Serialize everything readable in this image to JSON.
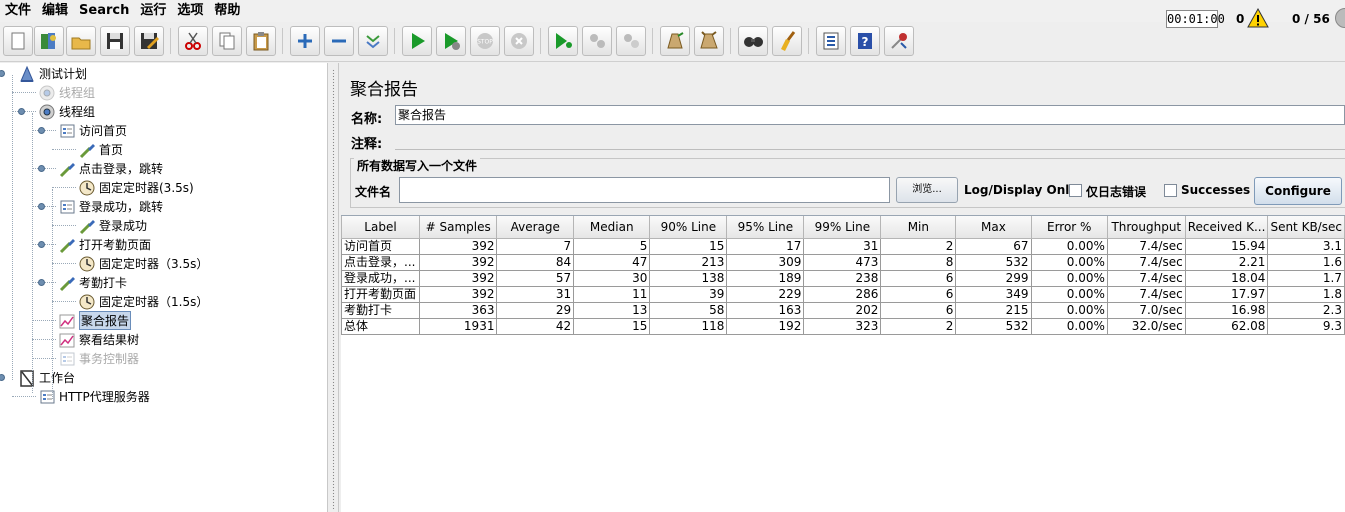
{
  "menu": [
    "文件",
    "编辑",
    "Search",
    "运行",
    "选项",
    "帮助"
  ],
  "toolbar": {
    "buttons": [
      "new-icon",
      "templates-icon",
      "open-icon",
      "save-icon",
      "save-as-icon",
      "cut-icon",
      "copy-icon",
      "paste-icon",
      "expand-icon",
      "collapse-icon",
      "toggle-icon",
      "start-icon",
      "start-no-pause-icon",
      "stop-icon",
      "shutdown-icon",
      "remote-start-icon",
      "remote-stop-icon",
      "remote-shutdown-icon",
      "clear-icon",
      "clear-all-icon",
      "search-icon",
      "reset-search-icon",
      "function-helper-icon",
      "help-icon",
      "log-viewer-icon"
    ],
    "elapsed": "00:01:00",
    "error_count": "0",
    "thread_count": "0 / 56"
  },
  "tree": [
    {
      "label": "测试计划",
      "icon": "test-plan-icon",
      "disabled": false,
      "selected": false
    },
    {
      "label": "线程组",
      "icon": "thread-group-icon",
      "disabled": true,
      "selected": false
    },
    {
      "label": "线程组",
      "icon": "thread-group-icon",
      "disabled": false,
      "selected": false
    },
    {
      "label": "访问首页",
      "icon": "transaction-controller-icon",
      "disabled": false,
      "selected": false
    },
    {
      "label": "首页",
      "icon": "http-sampler-icon",
      "disabled": false,
      "selected": false
    },
    {
      "label": "点击登录，跳转",
      "icon": "http-sampler-icon",
      "disabled": false,
      "selected": false
    },
    {
      "label": "固定定时器(3.5s)",
      "icon": "timer-icon",
      "disabled": false,
      "selected": false
    },
    {
      "label": "登录成功，跳转",
      "icon": "transaction-controller-icon",
      "disabled": false,
      "selected": false
    },
    {
      "label": "登录成功",
      "icon": "http-sampler-icon",
      "disabled": false,
      "selected": false
    },
    {
      "label": "打开考勤页面",
      "icon": "http-sampler-icon",
      "disabled": false,
      "selected": false
    },
    {
      "label": "固定定时器（3.5s）",
      "icon": "timer-icon",
      "disabled": false,
      "selected": false
    },
    {
      "label": "考勤打卡",
      "icon": "http-sampler-icon",
      "disabled": false,
      "selected": false
    },
    {
      "label": "固定定时器（1.5s）",
      "icon": "timer-icon",
      "disabled": false,
      "selected": false
    },
    {
      "label": "聚合报告",
      "icon": "listener-icon",
      "disabled": false,
      "selected": true
    },
    {
      "label": "察看结果树",
      "icon": "listener-icon",
      "disabled": false,
      "selected": false
    },
    {
      "label": "事务控制器",
      "icon": "transaction-controller-icon",
      "disabled": true,
      "selected": false
    },
    {
      "label": "工作台",
      "icon": "workbench-icon",
      "disabled": false,
      "selected": false
    },
    {
      "label": "HTTP代理服务器",
      "icon": "proxy-icon",
      "disabled": false,
      "selected": false
    }
  ],
  "panel": {
    "title": "聚合报告",
    "name_label": "名称:",
    "name_value": "聚合报告",
    "comment_label": "注释:",
    "comment_value": "",
    "group_title": "所有数据写入一个文件",
    "filename_label": "文件名",
    "filename_value": "",
    "browse_label": "浏览...",
    "log_display_label": "Log/Display Only:",
    "errors_only_label": "仅日志错误",
    "successes_label": "Successes",
    "configure_label": "Configure"
  },
  "table": {
    "headers": [
      "Label",
      "# Samples",
      "Average",
      "Median",
      "90% Line",
      "95% Line",
      "99% Line",
      "Min",
      "Max",
      "Error %",
      "Throughput",
      "Received K...",
      "Sent KB/sec"
    ],
    "rows": [
      [
        "访问首页",
        "392",
        "7",
        "5",
        "15",
        "17",
        "31",
        "2",
        "67",
        "0.00%",
        "7.4/sec",
        "15.94",
        "3.1"
      ],
      [
        "点击登录，...",
        "392",
        "84",
        "47",
        "213",
        "309",
        "473",
        "8",
        "532",
        "0.00%",
        "7.4/sec",
        "2.21",
        "1.6"
      ],
      [
        "登录成功，...",
        "392",
        "57",
        "30",
        "138",
        "189",
        "238",
        "6",
        "299",
        "0.00%",
        "7.4/sec",
        "18.04",
        "1.7"
      ],
      [
        "打开考勤页面",
        "392",
        "31",
        "11",
        "39",
        "229",
        "286",
        "6",
        "349",
        "0.00%",
        "7.4/sec",
        "17.97",
        "1.8"
      ],
      [
        "考勤打卡",
        "363",
        "29",
        "13",
        "58",
        "163",
        "202",
        "6",
        "215",
        "0.00%",
        "7.0/sec",
        "16.98",
        "2.3"
      ],
      [
        "总体",
        "1931",
        "42",
        "15",
        "118",
        "192",
        "323",
        "2",
        "532",
        "0.00%",
        "32.0/sec",
        "62.08",
        "9.3"
      ]
    ]
  }
}
